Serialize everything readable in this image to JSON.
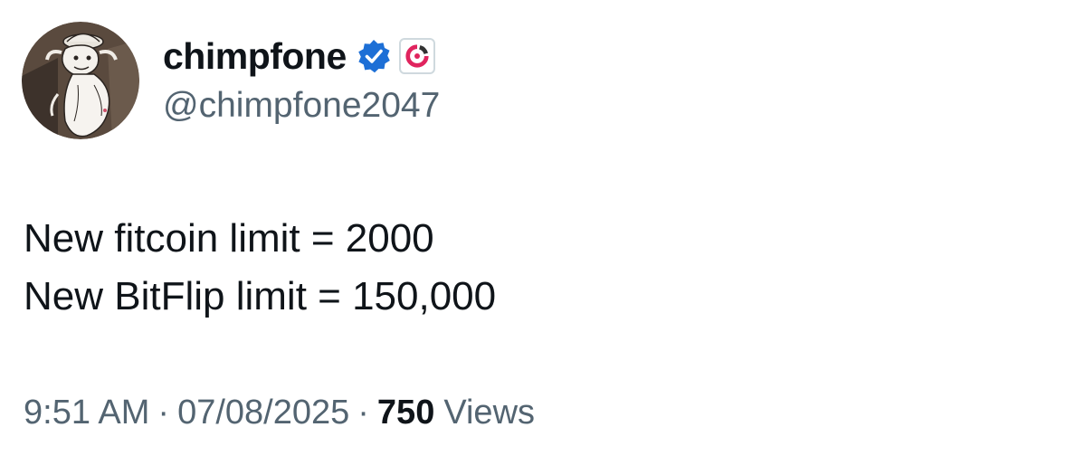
{
  "author": {
    "display_name": "chimpfone",
    "handle": "@chimpfone2047",
    "avatar_icon": "creature-sketch-avatar",
    "verified_icon": "verified-badge-icon",
    "affiliate_icon": "affiliate-logo-icon",
    "colors": {
      "verified": "#1d6fd6",
      "affiliate": "#e0245e"
    }
  },
  "tweet": {
    "lines": [
      "New fitcoin limit = 2000",
      "New BitFlip limit = 150,000"
    ]
  },
  "meta": {
    "time": "9:51 AM",
    "separator": "·",
    "date": "07/08/2025",
    "views_count": "750",
    "views_label": "Views"
  }
}
